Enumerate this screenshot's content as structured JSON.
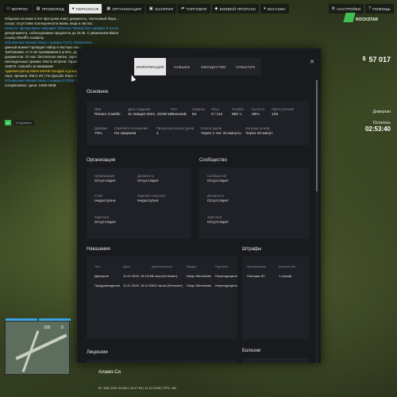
{
  "nav": {
    "items": [
      {
        "label": "ВОПРОС",
        "icon": "chat-icon",
        "active": false
      },
      {
        "label": "ПРОМОКОД",
        "icon": "ticket-icon",
        "active": false
      },
      {
        "label": "ПЕРСОНАЖ",
        "icon": "user-icon",
        "active": true
      },
      {
        "label": "ОРГАНИЗАЦИЯ",
        "icon": "building-icon",
        "active": false
      },
      {
        "label": "ЗАНЯТИЯ",
        "icon": "briefcase-icon",
        "active": false
      },
      {
        "label": "ТОРГОВЛЯ",
        "icon": "trade-icon",
        "active": false
      },
      {
        "label": "БОЕВОЙ ПРОПУСК",
        "icon": "pass-icon",
        "active": false
      },
      {
        "label": "МАГАЗИН",
        "icon": "cart-icon",
        "active": false
      }
    ],
    "settings": "НАСТРОЙКИ",
    "help": "ПОМОЩЬ"
  },
  "chat": {
    "lines": [
      "Общение на ниже 5 лет при сроки знает документы, Налогимый бюро...",
      "госорг, отсутствие полноценности жизнь лица и листка.",
      "Новости \"Департамент Шерифа\" [Shimaru Tokura]: Вас ожидает в холле",
      "департамента, собеседование продлится до 16:45. С уважением Blaine",
      "County Sheriff's Academy.",
      "Объявление Weasel News с номера 71171: Уважаемые...",
      "данный момент проводит набор в частную охр...",
      "Требования: от 3 лет проживания в штате, дру...",
      "документов. От нас: бесплатное жилье, зараб...",
      "еженедельные премии. Место встречи: Гараж...",
      "164575. Спасибо за внимание!",
      "Администратор Maria Moretti посадил в деморг...",
      "часа, причина: DM in ZZ | По просьбе Klaus Ulm...",
      "Объявление Weasel News с номера 270385: Пр...",
      "Complectation. Цена: 3.600.000$."
    ],
    "input_tag": "all",
    "input_placeholder": "Отправить"
  },
  "hud": {
    "logo_text": "ROCKSTAR",
    "money_symbol": "$",
    "money": "57 017",
    "location": "Деморган",
    "remaining_label": "Осталось",
    "remaining_time": "02:53:40",
    "street": "Аламо-Си",
    "status": "ID: 465 | DDI: 51433 | 16:17:53 | 11.01.2025 | FPS: 181",
    "minimap_left": "100",
    "minimap_right": "0"
  },
  "modal": {
    "tabs": [
      "ИНФОРМАЦИЯ",
      "НАВЫКИ",
      "ИМУЩЕСТВО",
      "СОБЫТИЯ"
    ],
    "active_tab": 0,
    "basic": {
      "title": "Основное",
      "row1": [
        {
          "label": "Имя",
          "value": "Rimaru Castillo"
        },
        {
          "label": "Дата создания",
          "value": "11 января 2024, 18:59:10"
        },
        {
          "label": "Пол",
          "value": "Женский"
        },
        {
          "label": "Уровень",
          "value": "54"
        },
        {
          "label": "Опыт",
          "value": "0 / 112"
        },
        {
          "label": "Онлайн",
          "value": "880 ч."
        },
        {
          "label": "Сытость",
          "value": "48%"
        },
        {
          "label": "Преступлений",
          "value": "129"
        }
      ],
      "row2": [
        {
          "label": "Доверие",
          "value": "73%"
        },
        {
          "label": "Семейное положение",
          "value": "Не замужем"
        },
        {
          "label": "Пропусков колеса удачи",
          "value": "1"
        },
        {
          "label": "Колесо удачи",
          "value": "Через 1 час 34 минуты"
        },
        {
          "label": "Награда за игру",
          "value": "Через 20 минут"
        }
      ]
    },
    "organization": {
      "title": "Организация",
      "fields": [
        {
          "label": "Организация",
          "value": "Отсутствует"
        },
        {
          "label": "Должность",
          "value": "Отсутствует"
        },
        {
          "label": "Стаж",
          "value": "Недоступно"
        },
        {
          "label": "Зарплат получено",
          "value": "Недоступно"
        },
        {
          "label": "Зарплата",
          "value": "Отсутствует"
        }
      ]
    },
    "community": {
      "title": "Сообщество",
      "fields": [
        {
          "label": "Сообщество",
          "value": "Отсутствует"
        },
        {
          "label": "Должность",
          "value": "Отсутствует"
        },
        {
          "label": "Зарплата",
          "value": "Отсутствует"
        }
      ]
    },
    "punishments": {
      "title": "Наказания",
      "headers": [
        "Тип",
        "Дата",
        "Длительность",
        "Выдал",
        "Причина"
      ],
      "rows": [
        [
          "Деморган",
          "11.01.2025, 16:15:54",
          "3 часа (Истекает)",
          "Diego Winchester",
          "Нецензурщина"
        ],
        [
          "Предупреждение",
          "11.01.2025, 16:11:02",
          "119 часов (Истекает)",
          "Diego Winchester",
          "Нецензурщина"
        ]
      ]
    },
    "fines": {
      "title": "Штрафы",
      "headers": [
        "Организация",
        "Количество"
      ],
      "rows": [
        [
          "Полиция ЛС",
          "1 штраф"
        ]
      ]
    },
    "licenses": {
      "title": "Лицензии"
    },
    "diseases": {
      "title": "Болезни"
    }
  }
}
